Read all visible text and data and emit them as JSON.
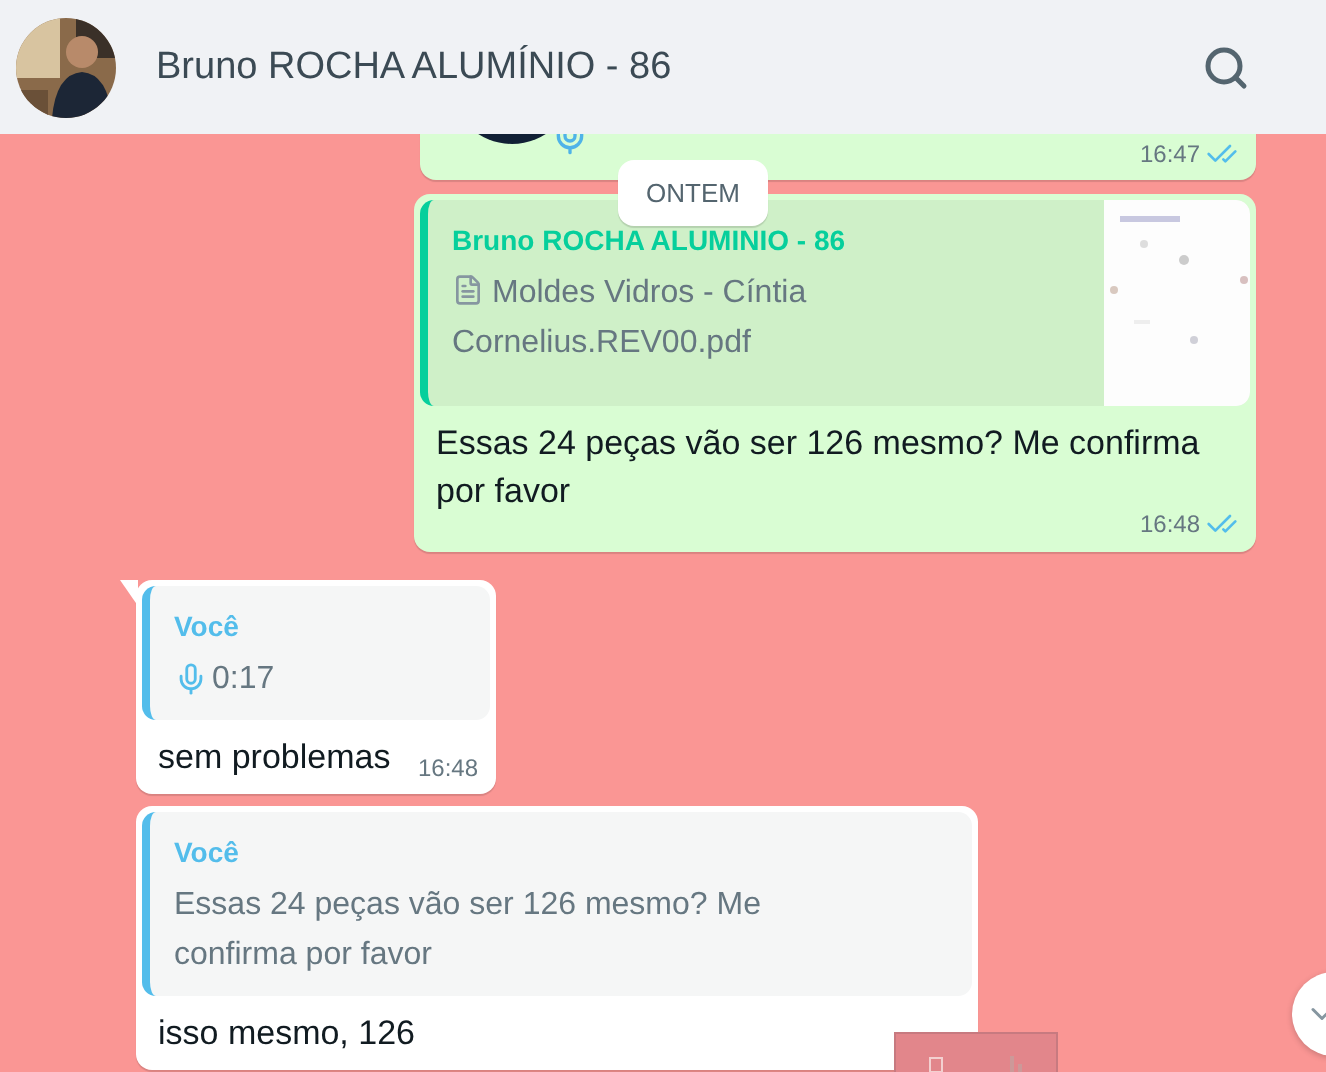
{
  "header": {
    "contact_name": "Bruno ROCHA ALUMÍNIO - 86"
  },
  "date_chip": "ONTEM",
  "messages": [
    {
      "kind": "audio",
      "outgoing": true,
      "time": "16:47",
      "read": true
    },
    {
      "kind": "reply",
      "outgoing": true,
      "quote": {
        "author": "Bruno ROCHA ALUMINIO - 86",
        "kind": "document",
        "text": "Moldes Vidros - Cíntia Cornelius.REV00.pdf",
        "thumbnail": true
      },
      "text": "Essas 24 peças vão ser 126 mesmo? Me confirma por favor",
      "time": "16:48",
      "read": true
    },
    {
      "kind": "reply",
      "outgoing": false,
      "quote": {
        "author": "Você",
        "kind": "audio",
        "text": "0:17"
      },
      "text": "sem problemas",
      "time": "16:48"
    },
    {
      "kind": "reply",
      "outgoing": false,
      "quote": {
        "author": "Você",
        "kind": "text",
        "text": "Essas 24 peças vão ser 126 mesmo? Me confirma por favor"
      },
      "text": "isso mesmo, 126"
    }
  ]
}
